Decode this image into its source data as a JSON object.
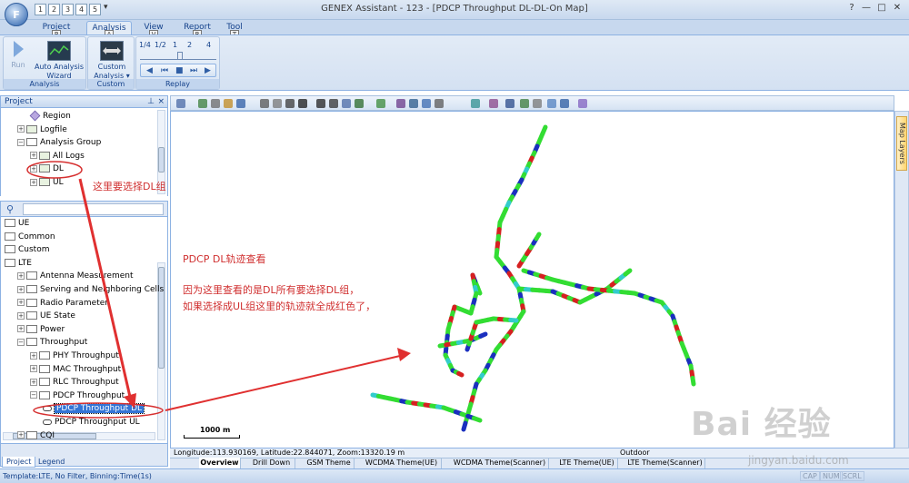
{
  "window": {
    "title": "GENEX Assistant - 123 - [PDCP Throughput DL-DL-On Map]",
    "app_button": "F",
    "quick_access": [
      "1",
      "2",
      "3",
      "4",
      "5"
    ],
    "controls": [
      "?",
      "—",
      "□",
      "✕"
    ]
  },
  "ribbon": {
    "tabs": [
      {
        "label": "Project",
        "key": "P"
      },
      {
        "label": "Analysis",
        "key": "A"
      },
      {
        "label": "View",
        "key": "V"
      },
      {
        "label": "Report",
        "key": "R"
      },
      {
        "label": "Tool",
        "key": "T"
      }
    ],
    "groups": {
      "analysis": {
        "label": "Analysis",
        "run": "Run",
        "auto_line1": "Auto Analysis",
        "auto_line2": "Wizard"
      },
      "custom": {
        "label": "Custom",
        "btn_line1": "Custom",
        "btn_line2": "Analysis ▾"
      },
      "replay": {
        "label": "Replay",
        "speeds": [
          "1/4",
          "1/2",
          "1",
          "2",
          "4"
        ]
      }
    }
  },
  "project_panel": {
    "header": "Project",
    "tree1": [
      {
        "label": "Region",
        "indent": 2,
        "exp": ""
      },
      {
        "label": "Logfile",
        "indent": 1,
        "exp": "+"
      },
      {
        "label": "Analysis Group",
        "indent": 1,
        "exp": "−"
      },
      {
        "label": "All Logs",
        "indent": 2,
        "exp": "+"
      },
      {
        "label": "DL",
        "indent": 2,
        "exp": "+"
      },
      {
        "label": "UL",
        "indent": 2,
        "exp": "+"
      }
    ],
    "tree2": [
      {
        "label": "UE",
        "indent": 0,
        "exp": ""
      },
      {
        "label": "Common",
        "indent": 0,
        "exp": ""
      },
      {
        "label": "Custom",
        "indent": 0,
        "exp": ""
      },
      {
        "label": "LTE",
        "indent": 0,
        "exp": ""
      },
      {
        "label": "Antenna Measurement",
        "indent": 1,
        "exp": "+"
      },
      {
        "label": "Serving and Neighboring Cells",
        "indent": 1,
        "exp": "+"
      },
      {
        "label": "Radio Parameter",
        "indent": 1,
        "exp": "+"
      },
      {
        "label": "UE State",
        "indent": 1,
        "exp": "+"
      },
      {
        "label": "Power",
        "indent": 1,
        "exp": "+"
      },
      {
        "label": "Throughput",
        "indent": 1,
        "exp": "−"
      },
      {
        "label": "PHY Throughput",
        "indent": 2,
        "exp": "+"
      },
      {
        "label": "MAC Throughput",
        "indent": 2,
        "exp": "+"
      },
      {
        "label": "RLC Throughput",
        "indent": 2,
        "exp": "+"
      },
      {
        "label": "PDCP Throughput",
        "indent": 2,
        "exp": "−"
      },
      {
        "label": "PDCP Throughput DL",
        "indent": 3,
        "exp": ""
      },
      {
        "label": "PDCP Throughput UL",
        "indent": 3,
        "exp": ""
      },
      {
        "label": "CQI",
        "indent": 1,
        "exp": "+"
      }
    ],
    "bottom_tabs": [
      "Project",
      "Legend"
    ]
  },
  "annotations": {
    "select_dl": "这里要选择DL组",
    "track_title": "PDCP DL轨迹查看",
    "explain_line1": "因为这里查看的是DL所有要选择DL组，",
    "explain_line2": "如果选择成UL组这里的轨迹就全成红色了，"
  },
  "map": {
    "scale_label": "1000 m",
    "layers_button": "Map Layers",
    "coords": "Longitude:113.930169, Latitude:22.844071, Zoom:13320.19 m",
    "scenario": "Outdoor",
    "track_colors": [
      "#33dd33",
      "#1a2fbf",
      "#d62020",
      "#33cccc",
      "#e8a020"
    ]
  },
  "theme_tabs": [
    "Overview",
    "Drill Down",
    "GSM Theme",
    "WCDMA Theme(UE)",
    "WCDMA Theme(Scanner)",
    "LTE Theme(UE)",
    "LTE Theme(Scanner)"
  ],
  "status": {
    "text": "Template:LTE,  No Filter,  Binning:Time(1s)",
    "indicators": [
      "CAP",
      "NUM",
      "SCRL"
    ]
  },
  "watermark": {
    "brand": "Bai  经验",
    "url": "jingyan.baidu.com"
  }
}
